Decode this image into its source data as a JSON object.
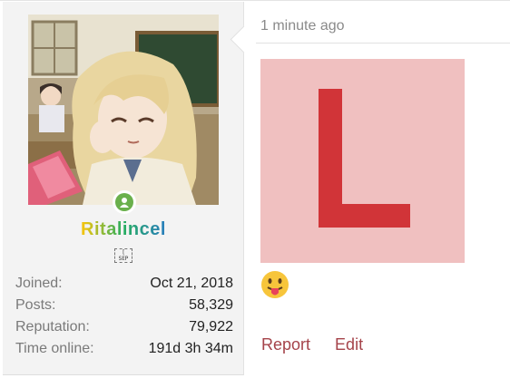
{
  "user": {
    "username": "Ritalincel",
    "title_glyph": "[ SEP ]",
    "online": true,
    "stats": [
      {
        "label": "Joined:",
        "value": "Oct 21, 2018"
      },
      {
        "label": "Posts:",
        "value": "58,329"
      },
      {
        "label": "Reputation:",
        "value": "79,922"
      },
      {
        "label": "Time online:",
        "value": "191d 3h 34m"
      }
    ]
  },
  "post": {
    "timestamp": "1 minute ago",
    "image_letter": "L",
    "emoji": "tongue-out-face",
    "actions": {
      "report": "Report",
      "edit": "Edit"
    }
  },
  "colors": {
    "accent_link": "#a5434a",
    "online": "#6ab04c",
    "image_bg": "#f0c0c0",
    "image_letter": "#d13438"
  }
}
